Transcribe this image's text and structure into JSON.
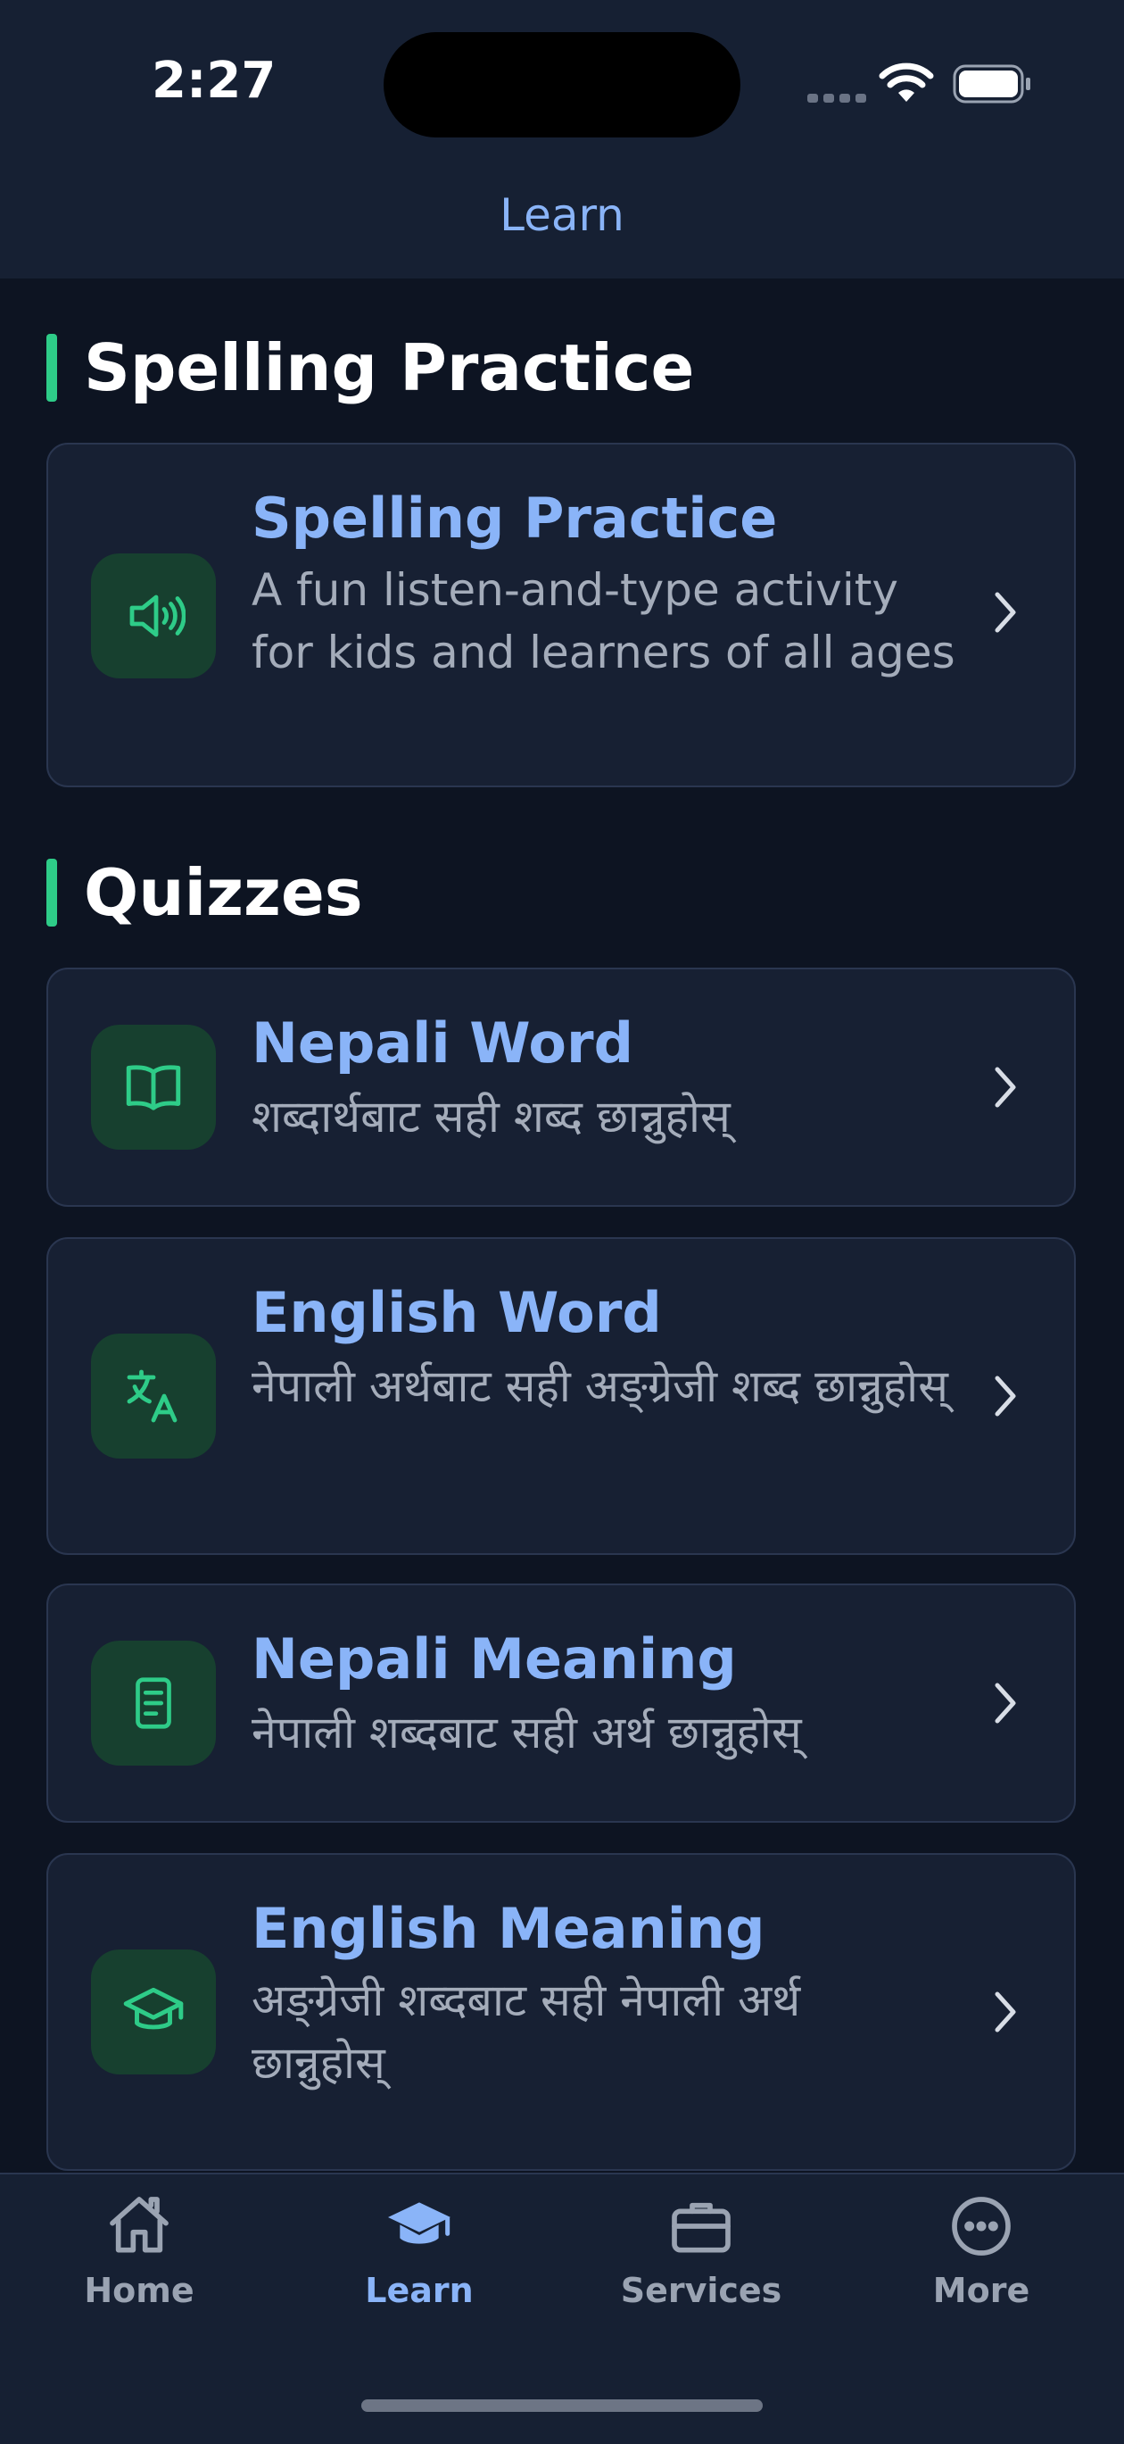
{
  "status": {
    "time": "2:27"
  },
  "header": {
    "title": "Learn"
  },
  "sections": [
    {
      "title": "Spelling Practice"
    },
    {
      "title": "Quizzes"
    }
  ],
  "cards": [
    {
      "title": "Spelling Practice",
      "subtitle": "A fun listen-and-type activity for kids and learners of all ages",
      "icon": "speaker-icon"
    },
    {
      "title": "Nepali Word",
      "subtitle": "शब्दार्थबाट सही शब्द छान्नुहोस्",
      "icon": "book-icon"
    },
    {
      "title": "English Word",
      "subtitle": "नेपाली अर्थबाट सही अङ्ग्रेजी शब्द छान्नुहोस्",
      "icon": "translate-icon"
    },
    {
      "title": "Nepali Meaning",
      "subtitle": "नेपाली शब्दबाट सही अर्थ छान्नुहोस्",
      "icon": "document-icon"
    },
    {
      "title": "English Meaning",
      "subtitle": "अङ्ग्रेजी शब्दबाट सही नेपाली अर्थ छान्नुहोस्",
      "icon": "graduation-cap-icon"
    }
  ],
  "tabs": [
    {
      "label": "Home",
      "icon": "home-icon",
      "active": false
    },
    {
      "label": "Learn",
      "icon": "graduation-cap-icon",
      "active": true
    },
    {
      "label": "Services",
      "icon": "briefcase-icon",
      "active": false
    },
    {
      "label": "More",
      "icon": "ellipsis-circle-icon",
      "active": false
    }
  ],
  "colors": {
    "accent": "#8ab4f8",
    "green": "#2ecc88",
    "background": "#0d1422",
    "card": "#172033"
  }
}
